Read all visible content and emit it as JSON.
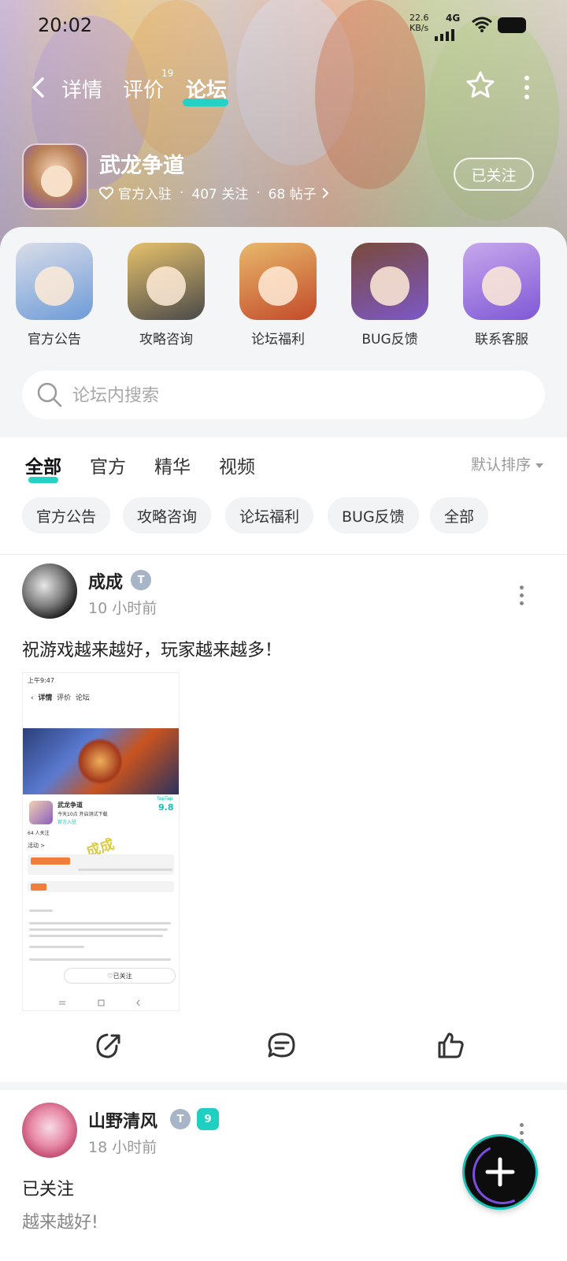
{
  "status_bar": {
    "time": "20:02",
    "speed": "22.6",
    "speed_unit": "KB/s",
    "network": "4G"
  },
  "nav": {
    "tabs": [
      "详情",
      "评价",
      "论坛"
    ],
    "active_tab": "论坛",
    "review_count": "19"
  },
  "game": {
    "title": "武龙争道",
    "official": "官方入驻",
    "followers": "407 关注",
    "posts": "68 帖子",
    "follow_label": "已关注"
  },
  "categories": [
    {
      "label": "官方公告"
    },
    {
      "label": "攻略咨询"
    },
    {
      "label": "论坛福利"
    },
    {
      "label": "BUG反馈"
    },
    {
      "label": "联系客服"
    }
  ],
  "search": {
    "placeholder": "论坛内搜索"
  },
  "feed_tabs": {
    "items": [
      "全部",
      "官方",
      "精华",
      "视频"
    ],
    "active": "全部",
    "sort_label": "默认排序"
  },
  "chips": [
    "官方公告",
    "攻略咨询",
    "论坛福利",
    "BUG反馈",
    "全部"
  ],
  "posts": [
    {
      "username": "成成",
      "time": "10 小时前",
      "text": "祝游戏越来越好，玩家越来越多！",
      "screenshot": {
        "status_time": "上午9:47",
        "tabs": [
          "详情",
          "评价",
          "论坛"
        ],
        "game_name": "武龙争道",
        "game_sub": "今天10点 开启测试下载",
        "official": "官方入驻",
        "score_brand": "TapTap",
        "score": "9.8",
        "follows": "64 人关注",
        "activity": "活动 >",
        "watermark": "成成",
        "follow_btn": "已关注"
      }
    },
    {
      "username": "山野清风",
      "level": "9",
      "time": "18 小时前",
      "text": "已关注",
      "subtext": "越来越好!"
    }
  ],
  "colors": {
    "accent": "#25d0c5",
    "fab": "#0d0d0d"
  }
}
